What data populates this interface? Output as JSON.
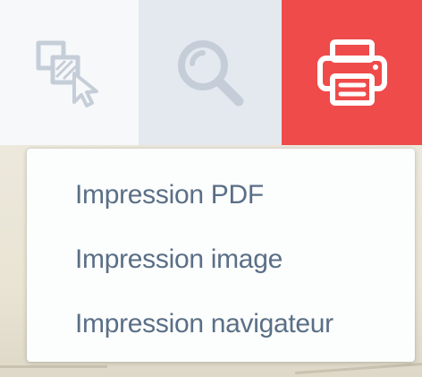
{
  "toolbar": {
    "buttons": [
      {
        "id": "select",
        "icon": "multi-select-cursor-icon",
        "active": false
      },
      {
        "id": "search",
        "icon": "search-icon",
        "active": false
      },
      {
        "id": "print",
        "icon": "printer-icon",
        "active": true
      }
    ],
    "colors": {
      "print_active_bg": "#ef4b4b",
      "search_bg": "#e4e9ef",
      "select_bg": "#f7f8fa",
      "icon_gray": "#c5ced8"
    }
  },
  "print_menu": {
    "items": [
      {
        "label": "Impression PDF"
      },
      {
        "label": "Impression image"
      },
      {
        "label": "Impression navigateur"
      }
    ],
    "text_color": "#5a6f86"
  }
}
